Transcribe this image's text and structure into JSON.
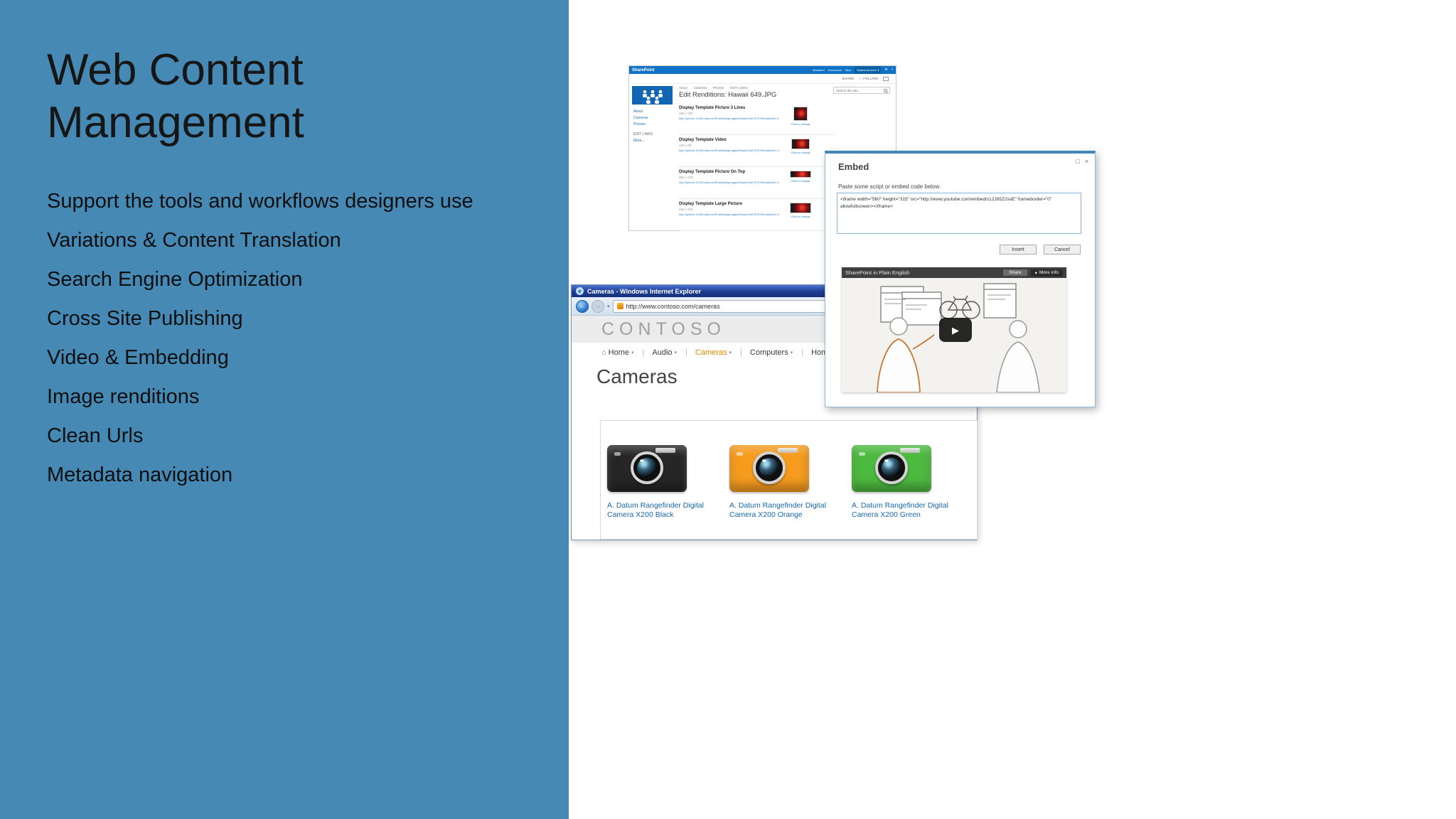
{
  "colors": {
    "panel_blue": "#4589b4",
    "sharepoint_blue": "#0e72c6",
    "link_blue": "#1568b0",
    "nav_active_orange": "#e18b00",
    "camera_black": "#262626",
    "camera_orange": "#f59b1e",
    "camera_green": "#4cb93f"
  },
  "icons": {
    "chevron_down": "▾",
    "close": "×",
    "maximize": "□",
    "gear": "⚙",
    "help": "?",
    "star": "☆",
    "home": "⌂",
    "back_arrow": "←",
    "forward_arrow": "→",
    "play": "▶",
    "ie_logo": "e"
  },
  "slide": {
    "title": "Web Content Management",
    "bullets": [
      "Support the tools and workflows designers use",
      "Variations & Content Translation",
      "Search Engine Optimization",
      "Cross Site Publishing",
      "Video & Embedding",
      "Image renditions",
      "Clean Urls",
      "Metadata navigation"
    ]
  },
  "sharepoint": {
    "brand": "SharePoint",
    "suite_links": [
      "Newsfeed",
      "Documents",
      "Sites"
    ],
    "account": "System Account",
    "share_label": "SHARE",
    "follow_label": "FOLLOW",
    "breadcrumb": [
      "About",
      "Cameras",
      "Phones",
      "EDIT LINKS"
    ],
    "page_title": "Edit Renditions: Hawaii 649.JPG",
    "search_placeholder": "Search this site...",
    "sidebar": [
      "About",
      "Cameras",
      "Phones",
      "EDIT LINKS",
      "More..."
    ],
    "click_to_change": "Click to change",
    "renditions": [
      {
        "name": "Display Template Picture 3 Lines",
        "size": "100 x 100",
        "url": "http://sphere-10150.sites.net/PublishingImages/Hawaii 649.JPG?RenditionID=1"
      },
      {
        "name": "Display Template Video",
        "size": "120 x 68",
        "url": "http://sphere-10150.sites.net/PublishingImages/Hawaii 649.JPG?RenditionID=4"
      },
      {
        "name": "Display Template Picture On Top",
        "size": "304 x 100",
        "url": "http://sphere-10150.sites.net/PublishingImages/Hawaii 649.JPG?RenditionID=2"
      },
      {
        "name": "Display Template Large Picture",
        "size": "468 x 220",
        "url": "http://sphere-10150.sites.net/PublishingImages/Hawaii 649.JPG?RenditionID=3"
      }
    ]
  },
  "embed": {
    "title": "Embed",
    "instruction": "Paste some script or embed code below.",
    "code": "<iframe width=\"560\" height=\"315\" src=\"http://www.youtube.com/embed/s12Jb5Z2xaE\" frameborder=\"0\" allowfullscreen></iframe>",
    "insert_label": "Insert",
    "cancel_label": "Cancel",
    "video_title": "SharePoint in Plain English",
    "share_label": "Share",
    "more_info_label": "More info"
  },
  "browser": {
    "window_title": "Cameras - Windows Internet Explorer",
    "url": "http://www.contoso.com/cameras",
    "site": "CONTOSO",
    "nav": [
      "Home",
      "Audio",
      "Cameras",
      "Computers",
      "Home ap"
    ],
    "heading": "Cameras",
    "products": [
      {
        "name": "A. Datum Rangefinder Digital Camera X200 Black",
        "color": "#262626"
      },
      {
        "name": "A. Datum Rangefinder Digital Camera X200 Orange",
        "color": "#f59b1e"
      },
      {
        "name": "A. Datum Rangefinder Digital Camera X200 Green",
        "color": "#4cb93f"
      }
    ]
  }
}
